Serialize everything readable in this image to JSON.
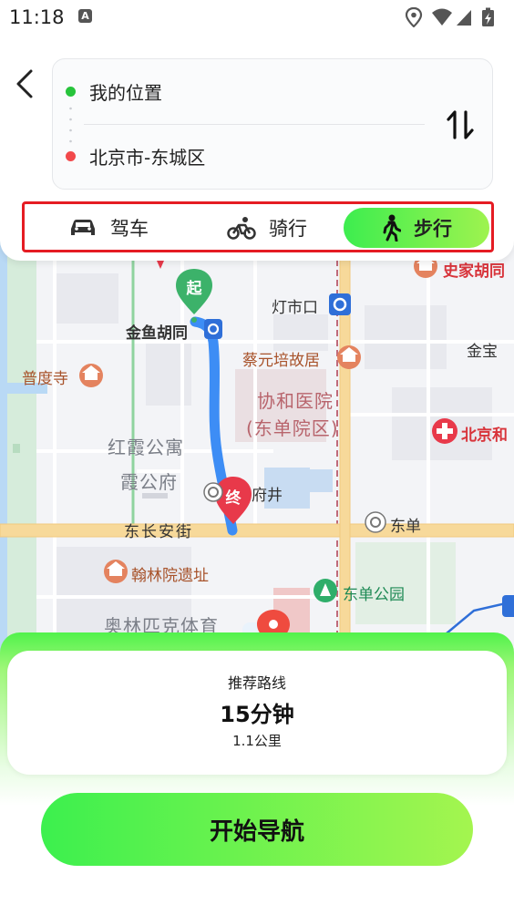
{
  "status_bar": {
    "time": "11:18",
    "notification_glyph": "A",
    "icons": [
      "location-icon",
      "wifi-icon",
      "signal-icon",
      "battery-charging-icon"
    ]
  },
  "route": {
    "origin": "我的位置",
    "destination": "北京市-东城区",
    "back_icon": "chevron-left-icon",
    "swap_icon": "swap-vertical-icon"
  },
  "modes": [
    {
      "label": "驾车",
      "icon": "car-icon",
      "selected": false
    },
    {
      "label": "骑行",
      "icon": "bicycle-icon",
      "selected": false
    },
    {
      "label": "步行",
      "icon": "walking-icon",
      "selected": true
    }
  ],
  "map": {
    "start_marker": "起",
    "end_marker": "终",
    "labels": {
      "shijia_hutong": "史家胡同",
      "dengshikou": "灯市口",
      "jinyu_hutong": "金鱼胡同",
      "jinbao": "金宝",
      "puducha": "普度寺",
      "cai_yuanpei": "蔡元培故居",
      "hospital_1": "协和医院",
      "hospital_2": "(东单院区)",
      "beijing_he": "北京和",
      "hongxia_1": "红霞公寓",
      "hongxia_2": "霞公府",
      "fujing": "府井",
      "dongchanganjie": "东长安街",
      "dongdan": "东单",
      "hanlinyuan": "翰林院遗址",
      "dongdan_park": "东单公园",
      "olympic": "奥林匹克体育"
    },
    "colors": {
      "route": "#3d8df5",
      "start_pin": "#3cb26a",
      "end_pin": "#e8394a",
      "main_road": "#f7d99a"
    }
  },
  "summary": {
    "title": "推荐路线",
    "duration": "15分钟",
    "distance": "1.1公里"
  },
  "actions": {
    "start_navigation": "开始导航"
  },
  "theme": {
    "accent_start": "#3ded4f",
    "accent_end": "#a4f54f",
    "highlight_border": "#e51c23"
  }
}
